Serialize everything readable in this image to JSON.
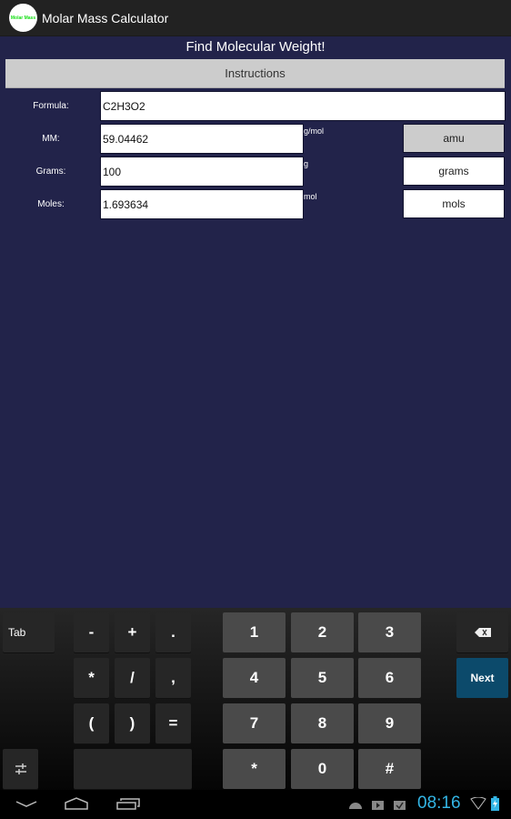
{
  "action_bar": {
    "app_icon_text": "Molar Mass",
    "title": "Molar Mass Calculator"
  },
  "main": {
    "headline": "Find Molecular Weight!",
    "instructions_button": "Instructions",
    "rows": [
      {
        "label": "Formula:",
        "value": "C2H3O2",
        "unit": "",
        "unit_button": ""
      },
      {
        "label": "MM:",
        "value": "59.04462",
        "unit": "g/mol",
        "unit_button": "amu"
      },
      {
        "label": "Grams:",
        "value": "100",
        "unit": "g",
        "unit_button": "grams"
      },
      {
        "label": "Moles:",
        "value": "1.693634",
        "unit": "mol",
        "unit_button": "mols"
      }
    ],
    "active_unit_button": "amu"
  },
  "keyboard": {
    "tab": "Tab",
    "symbols": [
      "-",
      "+",
      ".",
      "*",
      "/",
      ",",
      "(",
      ")",
      "="
    ],
    "digits": [
      "1",
      "2",
      "3",
      "4",
      "5",
      "6",
      "7",
      "8",
      "9",
      "*",
      "0",
      "#"
    ],
    "next": "Next",
    "accent_color": "#0c4a6b"
  },
  "system_bar": {
    "clock": "08:16",
    "clock_color": "#33b5e5",
    "status_icons": [
      "android-debug-icon",
      "play-store-icon",
      "download-complete-icon",
      "wifi-icon",
      "battery-charging-icon"
    ]
  }
}
